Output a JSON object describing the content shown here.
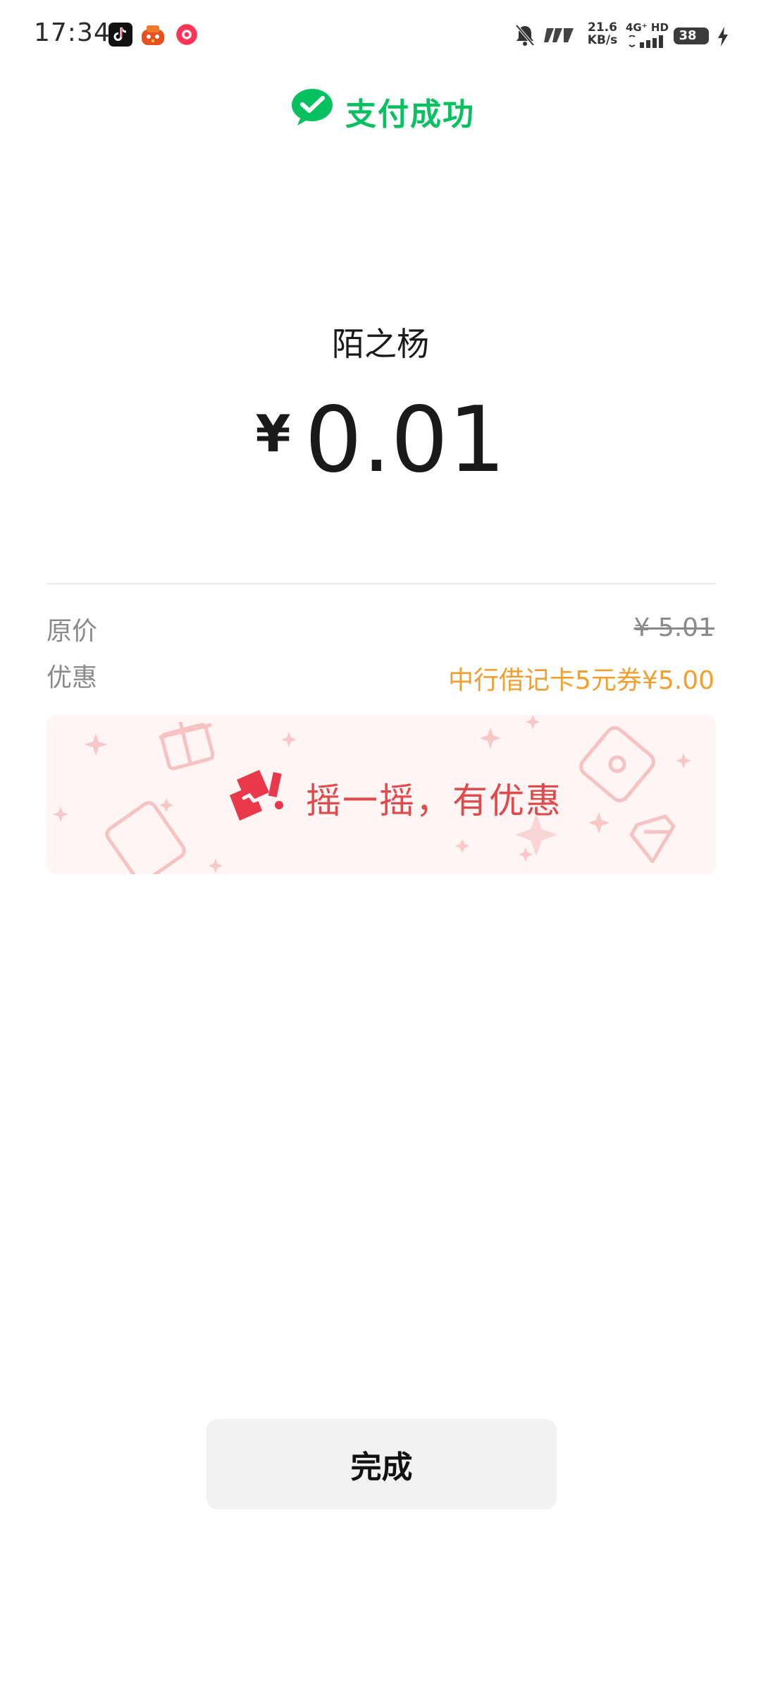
{
  "status_bar": {
    "time": "17:34",
    "net_speed_value": "21.6",
    "net_speed_unit": "KB/s",
    "network_type": "4G⁺ HD",
    "battery_level": "38",
    "icons": [
      "douyin-app-icon",
      "taobao-app-icon",
      "weibo-app-icon",
      "mute-bell-icon",
      "nfc-icon",
      "signal-icon",
      "charging-icon"
    ]
  },
  "header": {
    "title": "支付成功",
    "icon": "wechat-pay-icon",
    "color": "#07c160"
  },
  "payment": {
    "payee": "陌之杨",
    "currency_symbol": "¥",
    "amount": "0.01"
  },
  "details": {
    "original_price_label": "原价",
    "original_price_value": "¥ 5.01",
    "discount_label": "优惠",
    "discount_value": "中行借记卡5元券¥5.00",
    "discount_color": "#f0a030"
  },
  "banner": {
    "text": "摇一摇，有优惠",
    "icon": "shake-phone-icon",
    "color": "#e04a4a"
  },
  "actions": {
    "done_label": "完成"
  }
}
